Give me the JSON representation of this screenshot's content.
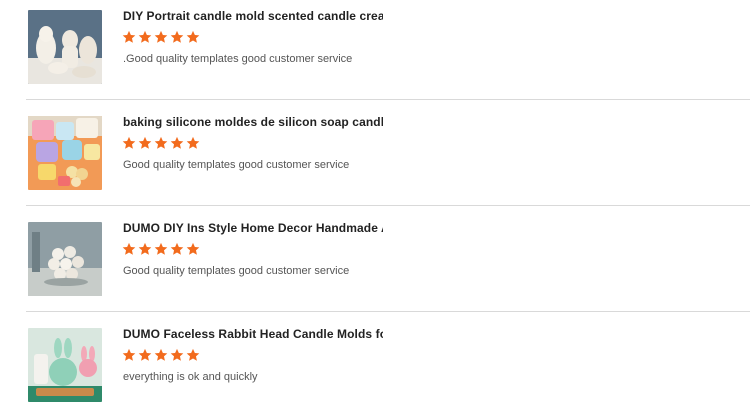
{
  "reviews": [
    {
      "product_title": "DIY Portrait candle mold scented candle creati...",
      "rating": 5,
      "comment": ".Good quality templates good customer service",
      "image_icon": "white-portrait-candles-photo"
    },
    {
      "product_title": "baking silicone moldes de silicon soap candle ...",
      "rating": 5,
      "comment": "Good quality templates good customer service",
      "image_icon": "colorful-bubble-cube-candles-photo"
    },
    {
      "product_title": "DUMO DIY Ins Style Home Decor Handmade Ar...",
      "rating": 5,
      "comment": "Good quality templates good customer service",
      "image_icon": "white-bubble-candle-photo"
    },
    {
      "product_title": "DUMO Faceless Rabbit Head Candle Molds for ...",
      "rating": 5,
      "comment": "everything is ok and quickly",
      "image_icon": "rabbit-head-candles-photo"
    }
  ],
  "colors": {
    "star": "#f26b1d",
    "divider": "#d9d9d9",
    "title": "#222222",
    "comment": "#555555"
  }
}
